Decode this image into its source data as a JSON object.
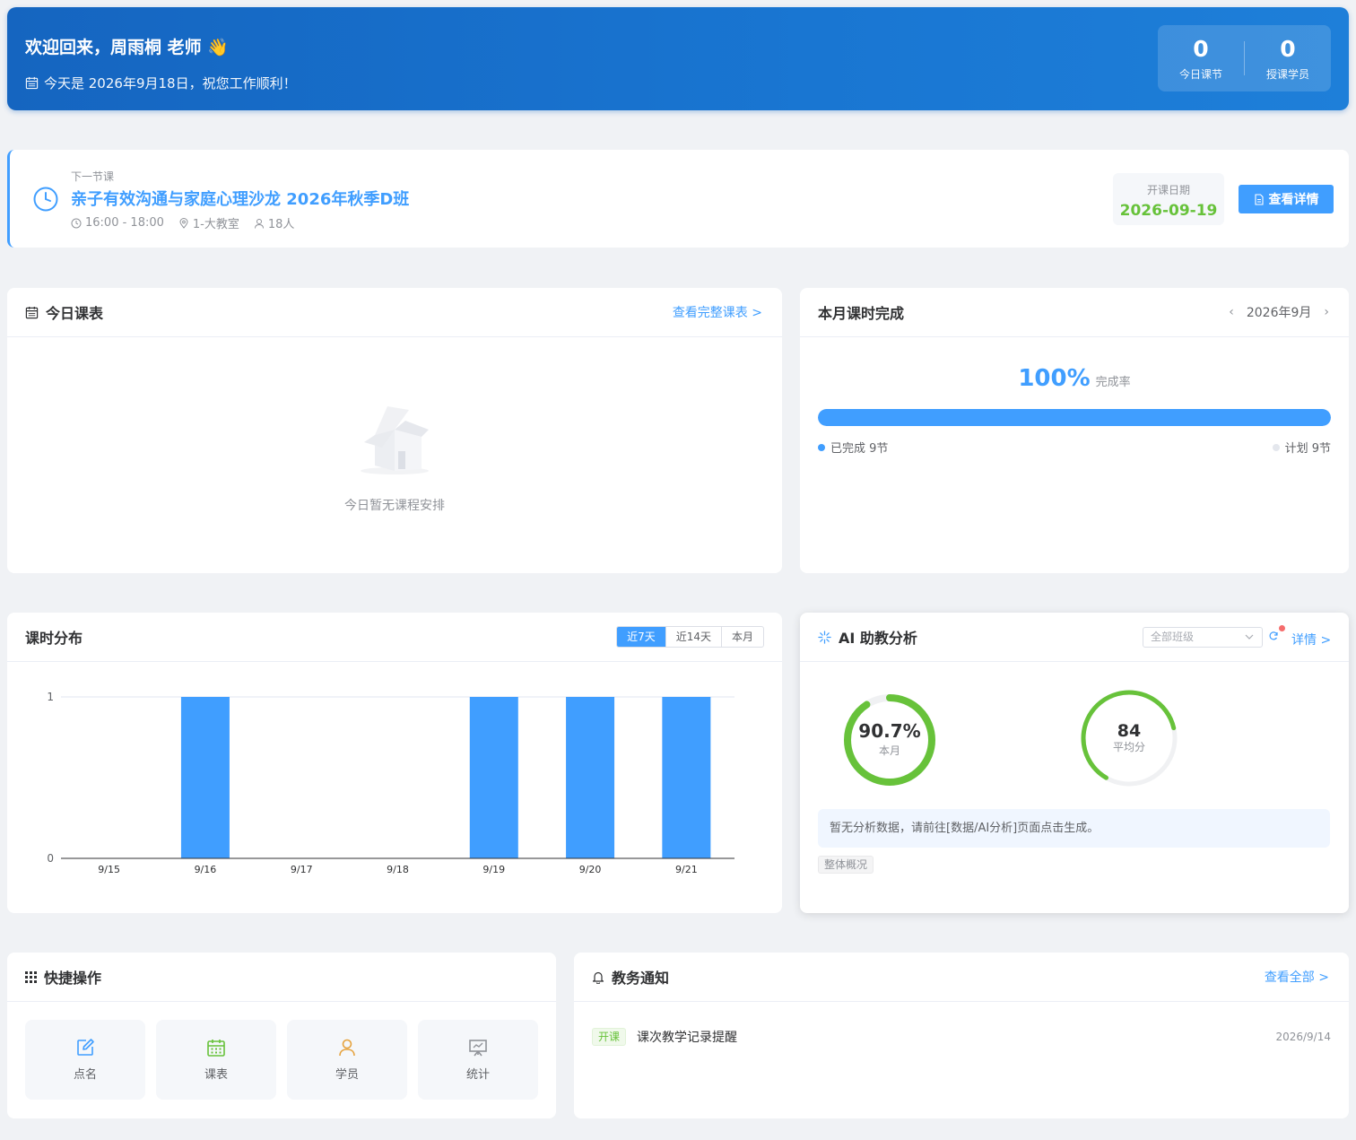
{
  "banner": {
    "greeting": "欢迎回来，周雨桐 老师 👋",
    "date_text": "今天是 2026年9月18日，祝您工作顺利！",
    "stats": [
      {
        "value": "0",
        "label": "今日课节"
      },
      {
        "value": "0",
        "label": "授课学员"
      }
    ]
  },
  "next_class": {
    "kicker": "下一节课",
    "title": "亲子有效沟通与家庭心理沙龙 2026年秋季D班",
    "time": "16:00 - 18:00",
    "room": "1-大教室",
    "students": "18人",
    "start_label": "开课日期",
    "start_date": "2026-09-19",
    "detail_button": "查看详情"
  },
  "schedule": {
    "title": "今日课表",
    "link": "查看完整课表 >",
    "empty_text": "今日暂无课程安排"
  },
  "monthly": {
    "title": "本月课时完成",
    "month": "2026年9月",
    "rate": "100%",
    "rate_label": "完成率",
    "progress": 1.0,
    "completed": "已完成 9节",
    "planned": "计划 9节"
  },
  "distribution": {
    "title": "课时分布",
    "ranges": [
      "近7天",
      "近14天",
      "本月"
    ],
    "active_range": 0
  },
  "chart_data": {
    "type": "bar",
    "categories": [
      "9/15",
      "9/16",
      "9/17",
      "9/18",
      "9/19",
      "9/20",
      "9/21"
    ],
    "values": [
      0,
      1,
      0,
      0,
      1,
      1,
      1
    ],
    "ylim": [
      0,
      1
    ],
    "yticks": [
      "0",
      "1"
    ],
    "title": "",
    "xlabel": "",
    "ylabel": "",
    "bar_color": "#409eff"
  },
  "ai": {
    "title": "AI 助教分析",
    "class_select": "全部班级",
    "detail_link": "详情 >",
    "gauge_month": {
      "value": "90.7%",
      "caption": "本月",
      "fraction": 0.907
    },
    "gauge_avg": {
      "value": "84",
      "caption": "平均分",
      "fraction": 0.84
    },
    "notice": "暂无分析数据，请前往[数据/AI分析]页面点击生成。",
    "tag": "整体概况"
  },
  "quick": {
    "title": "快捷操作",
    "items": [
      {
        "label": "点名",
        "icon": "edit-icon",
        "color": "#409eff"
      },
      {
        "label": "课表",
        "icon": "calendar-icon",
        "color": "#67c23a"
      },
      {
        "label": "学员",
        "icon": "user-icon",
        "color": "#e6a23c"
      },
      {
        "label": "统计",
        "icon": "presentation-icon",
        "color": "#909399"
      }
    ]
  },
  "notify": {
    "title": "教务通知",
    "link": "查看全部 >",
    "items": [
      {
        "badge": "开课",
        "text": "课次教学记录提醒",
        "time": "2026/9/14"
      }
    ]
  }
}
